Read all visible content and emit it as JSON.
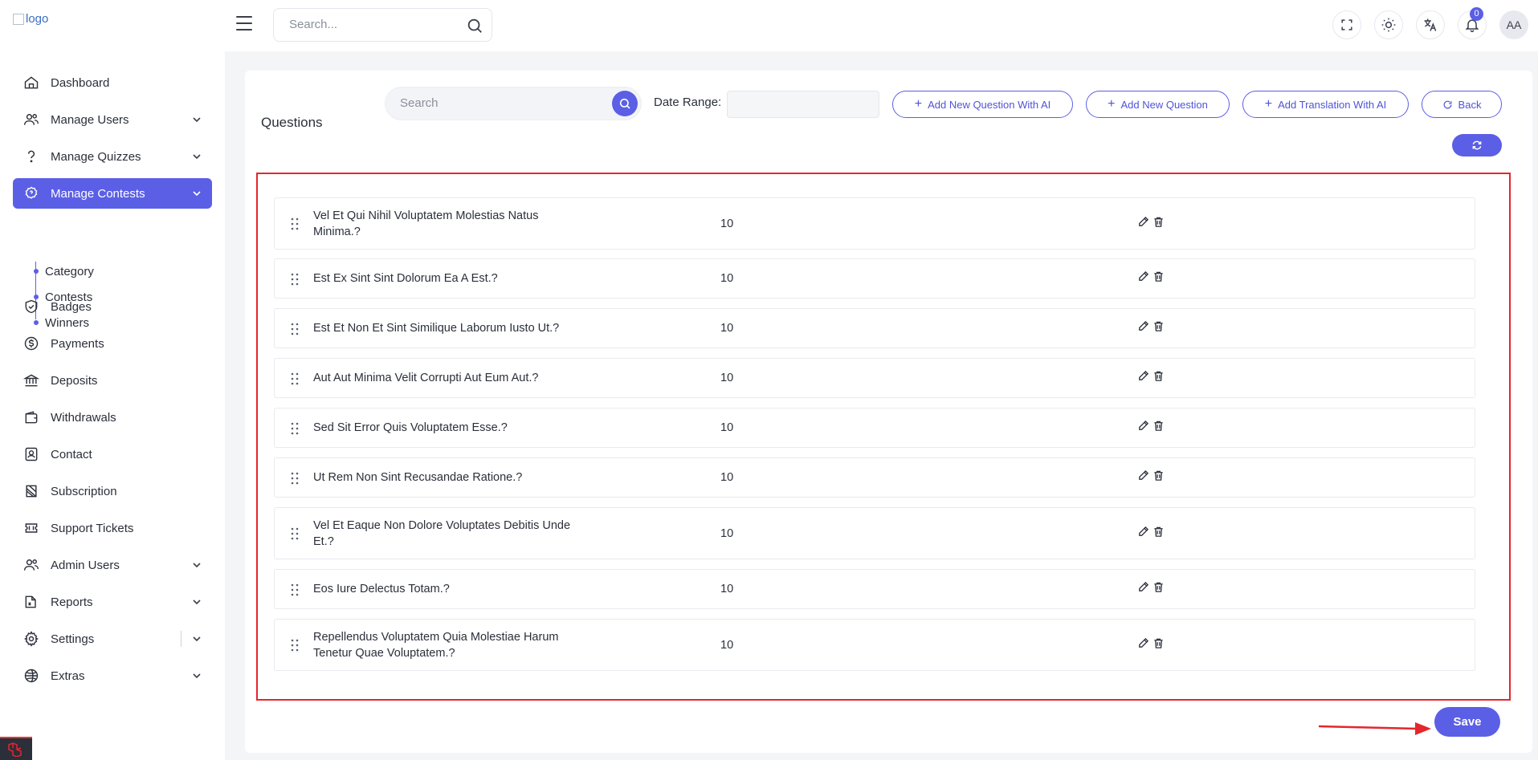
{
  "header": {
    "logo_alt": "logo",
    "search_placeholder": "Search...",
    "notification_count": "0",
    "avatar_initials": "AA"
  },
  "sidebar": {
    "items": [
      {
        "label": "Dashboard",
        "icon": "home-icon"
      },
      {
        "label": "Manage Users",
        "icon": "users-icon",
        "expandable": true
      },
      {
        "label": "Manage Quizzes",
        "icon": "question-icon",
        "expandable": true
      },
      {
        "label": "Manage Contests",
        "icon": "contest-icon",
        "expandable": true,
        "active": true
      },
      {
        "label": "Badges",
        "icon": "shield-check-icon"
      },
      {
        "label": "Payments",
        "icon": "dollar-circle-icon"
      },
      {
        "label": "Deposits",
        "icon": "bank-icon"
      },
      {
        "label": "Withdrawals",
        "icon": "wallet-icon"
      },
      {
        "label": "Contact",
        "icon": "contact-icon"
      },
      {
        "label": "Subscription",
        "icon": "subscription-icon"
      },
      {
        "label": "Support Tickets",
        "icon": "ticket-icon"
      },
      {
        "label": "Admin Users",
        "icon": "admin-users-icon",
        "expandable": true
      },
      {
        "label": "Reports",
        "icon": "reports-icon",
        "expandable": true
      },
      {
        "label": "Settings",
        "icon": "gear-icon",
        "expandable": true
      },
      {
        "label": "Extras",
        "icon": "extras-icon",
        "expandable": true
      }
    ],
    "contest_subitems": [
      "Category",
      "Contests",
      "Winners"
    ]
  },
  "main": {
    "title": "Questions",
    "search_placeholder": "Search",
    "date_range_label": "Date Range:",
    "buttons": {
      "add_ai": "Add New Question With AI",
      "add_new": "Add New Question",
      "add_translation": "Add Translation With AI",
      "back": "Back",
      "save": "Save"
    },
    "questions": [
      {
        "text": "Vel Et Qui Nihil Voluptatem Molestias Natus Minima.?",
        "points": "10"
      },
      {
        "text": "Est Ex Sint Sint Dolorum Ea A Est.?",
        "points": "10"
      },
      {
        "text": "Est Et Non Et Sint Similique Laborum Iusto Ut.?",
        "points": "10"
      },
      {
        "text": "Aut Aut Minima Velit Corrupti Aut Eum Aut.?",
        "points": "10"
      },
      {
        "text": "Sed Sit Error Quis Voluptatem Esse.?",
        "points": "10"
      },
      {
        "text": "Ut Rem Non Sint Recusandae Ratione.?",
        "points": "10"
      },
      {
        "text": "Vel Et Eaque Non Dolore Voluptates Debitis Unde Et.?",
        "points": "10"
      },
      {
        "text": "Eos Iure Delectus Totam.?",
        "points": "10"
      },
      {
        "text": "Repellendus Voluptatem Quia Molestiae Harum Tenetur Quae Voluptatem.?",
        "points": "10"
      }
    ]
  },
  "colors": {
    "accent": "#5b5fe6",
    "highlight_border": "#e5262d"
  }
}
